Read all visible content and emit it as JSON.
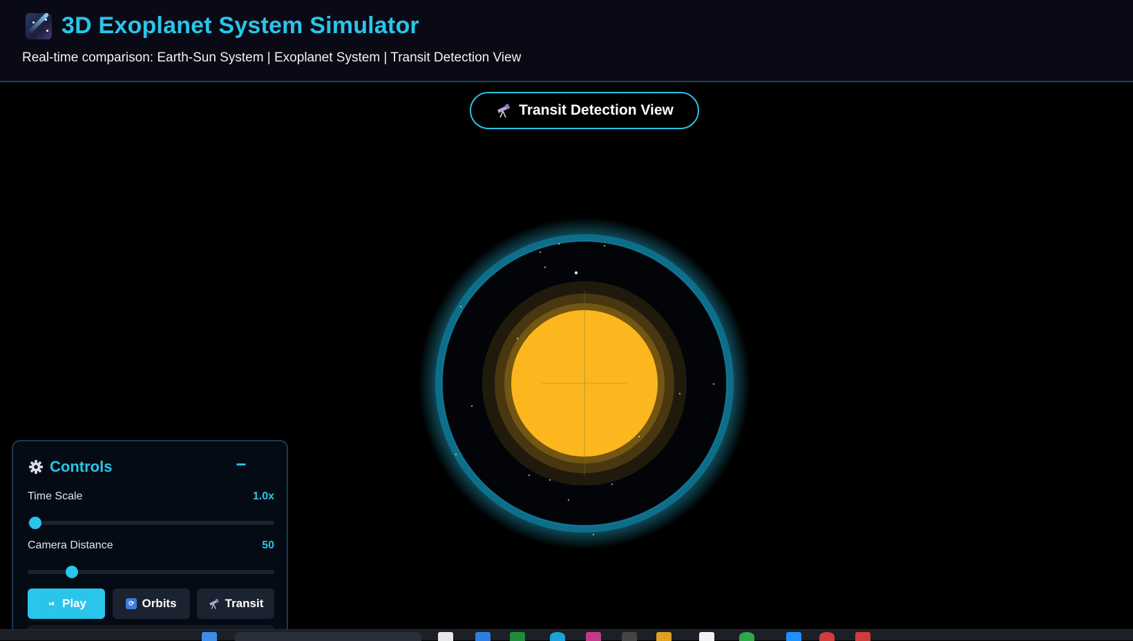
{
  "header": {
    "title": "3D Exoplanet System Simulator",
    "subtitle": "Real-time comparison: Earth-Sun System | Exoplanet System | Transit Detection View",
    "icon": "comet-icon"
  },
  "view_button": {
    "label": "Transit Detection View",
    "icon": "telescope-icon"
  },
  "controls": {
    "title": "Controls",
    "collapse_label": "−",
    "time_scale": {
      "label": "Time Scale",
      "value": "1.0x",
      "fraction": 0.03
    },
    "camera_distance": {
      "label": "Camera Distance",
      "value": "50",
      "fraction": 0.18
    },
    "buttons": {
      "play": "Play",
      "orbits": "Orbits",
      "transit": "Transit"
    }
  },
  "colors": {
    "accent": "#29c5ea",
    "star": "#fcb71e",
    "header_bg": "#0a0a16"
  }
}
